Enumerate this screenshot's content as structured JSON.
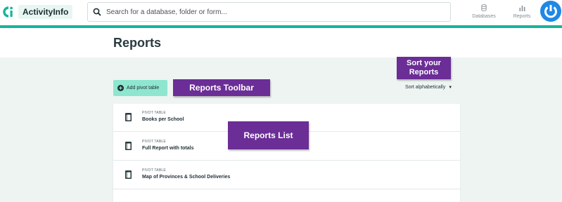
{
  "header": {
    "app_name": "ActivityInfo",
    "search_placeholder": "Search for a database, folder or form...",
    "nav": [
      {
        "label": "Databases",
        "icon": "database-icon"
      },
      {
        "label": "Reports",
        "icon": "bar-chart-icon"
      }
    ],
    "avatar_icon": "power-icon"
  },
  "page": {
    "title": "Reports"
  },
  "toolbar": {
    "add_label": "Add pivot table",
    "add_icon": "plus-circle-icon",
    "sort_label": "Sort alphabetically",
    "sort_icon": "caret-down-icon"
  },
  "reports": [
    {
      "type": "PIVOT TABLE",
      "name": "Books per School",
      "icon": "spreadsheet-icon"
    },
    {
      "type": "PIVOT TABLE",
      "name": "Full Report with totals",
      "icon": "spreadsheet-icon"
    },
    {
      "type": "PIVOT TABLE",
      "name": "Map of Provinces & School Deliveries",
      "icon": "spreadsheet-icon"
    }
  ],
  "annotations": {
    "toolbar": "Reports Toolbar",
    "sort_line1": "Sort your",
    "sort_line2": "Reports",
    "list": "Reports List"
  },
  "colors": {
    "accent": "#17b59a",
    "add_button": "#8ee6cf",
    "callout": "#6b2d96",
    "avatar": "#1e88e5",
    "page_bg": "#eef4f2"
  }
}
